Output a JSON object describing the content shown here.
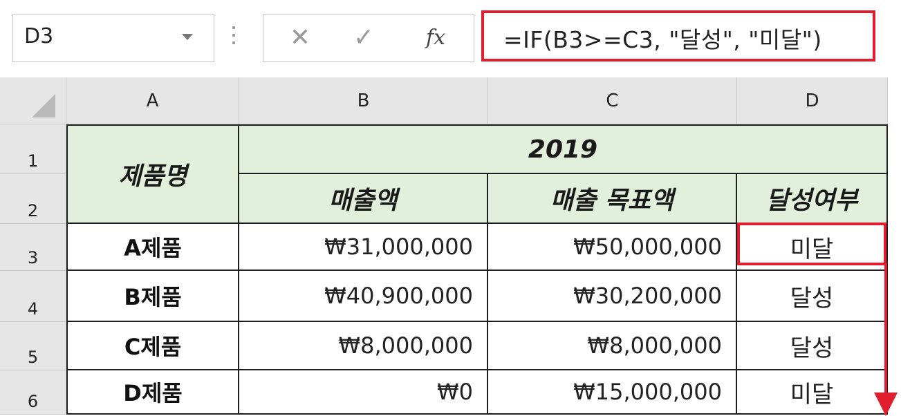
{
  "name_box": {
    "cell_ref": "D3"
  },
  "formula_bar": {
    "cancel_glyph": "✕",
    "enter_glyph": "✓",
    "fx_glyph": "fx",
    "formula": "=IF(B3>=C3, \"달성\", \"미달\")",
    "highlight_color": "#e01e2d"
  },
  "columns": [
    "A",
    "B",
    "C",
    "D"
  ],
  "rows": [
    "1",
    "2",
    "3",
    "4",
    "5",
    "6"
  ],
  "table": {
    "header_fill": "#e2efda",
    "product_header": "제품명",
    "year": "2019",
    "sales_header": "매출액",
    "target_header": "매출 목표액",
    "achieved_header": "달성여부",
    "rows": [
      {
        "product": "A제품",
        "sales": "₩31,000,000",
        "target": "₩50,000,000",
        "result": "미달"
      },
      {
        "product": "B제품",
        "sales": "₩40,900,000",
        "target": "₩30,200,000",
        "result": "달성"
      },
      {
        "product": "C제품",
        "sales": "₩8,000,000",
        "target": "₩8,000,000",
        "result": "달성"
      },
      {
        "product": "D제품",
        "sales": "₩0",
        "target": "₩15,000,000",
        "result": "미달"
      }
    ]
  }
}
